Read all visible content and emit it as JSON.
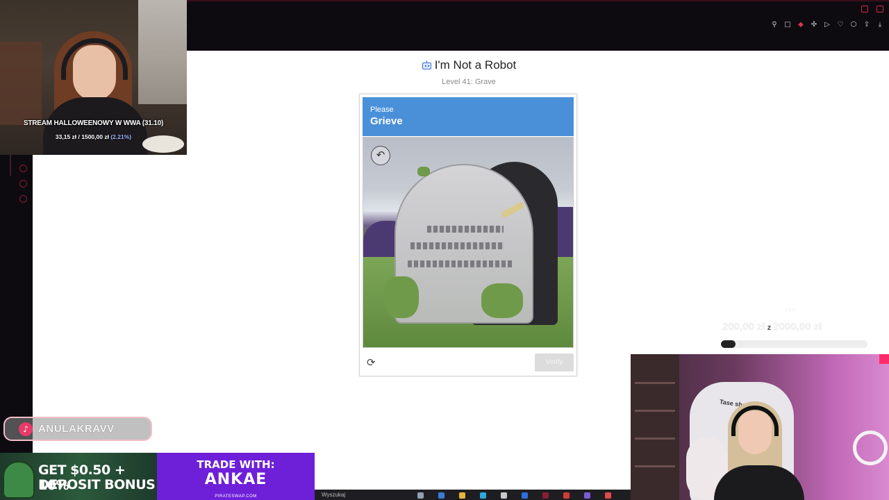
{
  "stream": {
    "title": "STREAM HALLOWEENOWY W WWA (31.10)",
    "goal_current": "33,15 zł",
    "goal_sep": " / ",
    "goal_target": "1500,00 zł",
    "goal_percent": "(2.21%)",
    "goal_progress": 0.0221
  },
  "page": {
    "title": "I'm Not a Robot",
    "level": "Level 41: Grave"
  },
  "captcha": {
    "prompt_prefix": "Please",
    "prompt_word": "Grieve",
    "undo_icon": "undo-arrow-icon",
    "reload_icon": "reload-icon",
    "verify_label": "Verify",
    "header_color": "#4a90d9"
  },
  "donation_goal": {
    "label": "24H",
    "current": "200,00 zł",
    "separator": "z",
    "target": "2000,00 zł",
    "progress": 0.1
  },
  "tiktok": {
    "icon": "tiktok-icon",
    "username": "ANULAKRAVV"
  },
  "banner": {
    "bonus_amount": "GET $0.50 + 10%",
    "bonus_line2": "DEPOSIT BONUS",
    "trade_line1": "TRADE WITH:",
    "trade_line2": "ANKAE",
    "site": "PIRATESWAP.COM"
  },
  "webcam2": {
    "chair_text": "Tase sho"
  },
  "taskbar": {
    "search_text": "Wyszukaj"
  },
  "colors": {
    "accent_red": "#e0314f",
    "topbar_bg": "#0d0b10",
    "verify_disabled": "#dcdcdc"
  }
}
